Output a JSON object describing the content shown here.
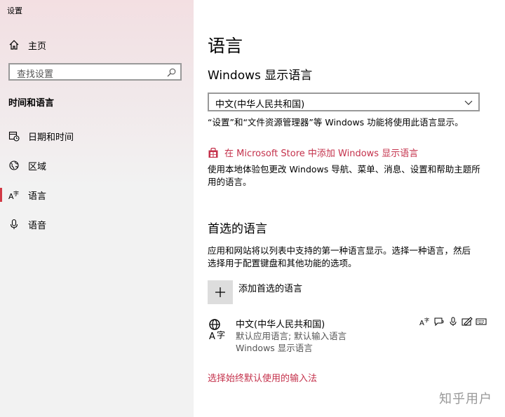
{
  "app": {
    "title": "设置"
  },
  "sidebar": {
    "home_label": "主页",
    "search_placeholder": "查找设置",
    "section_title": "时间和语言",
    "items": [
      {
        "label": "日期和时间",
        "icon": "calendar-clock-icon"
      },
      {
        "label": "区域",
        "icon": "globe-region-icon"
      },
      {
        "label": "语言",
        "icon": "language-icon",
        "selected": true
      },
      {
        "label": "语音",
        "icon": "microphone-icon"
      }
    ]
  },
  "main": {
    "title": "语言",
    "display_language": {
      "heading": "Windows 显示语言",
      "selected": "中文(中华人民共和国)",
      "description": "“设置”和“文件资源管理器”等 Windows 功能将使用此语言显示。",
      "store_link": "在 Microsoft Store 中添加 Windows 显示语言",
      "store_description": "使用本地体验包更改 Windows 导航、菜单、消息、设置和帮助主题所用的语言。"
    },
    "preferred": {
      "heading": "首选的语言",
      "description": "应用和网站将以列表中支持的第一种语言显示。选择一种语言，然后选择用于配置键盘和其他功能的选项。",
      "add_label": "添加首选的语言",
      "languages": [
        {
          "name": "中文(中华人民共和国)",
          "line1": "默认应用语言; 默认输入语言",
          "line2": "Windows 显示语言",
          "features": [
            "display-language-icon",
            "speech-icon",
            "microphone-icon",
            "handwriting-icon",
            "keyboard-icon"
          ]
        }
      ]
    },
    "input_method_link": "选择始终默认使用的输入法"
  },
  "watermark": "知乎用户",
  "colors": {
    "accent": "#c4314b",
    "sidebar_bg": "#f2f2f2"
  }
}
